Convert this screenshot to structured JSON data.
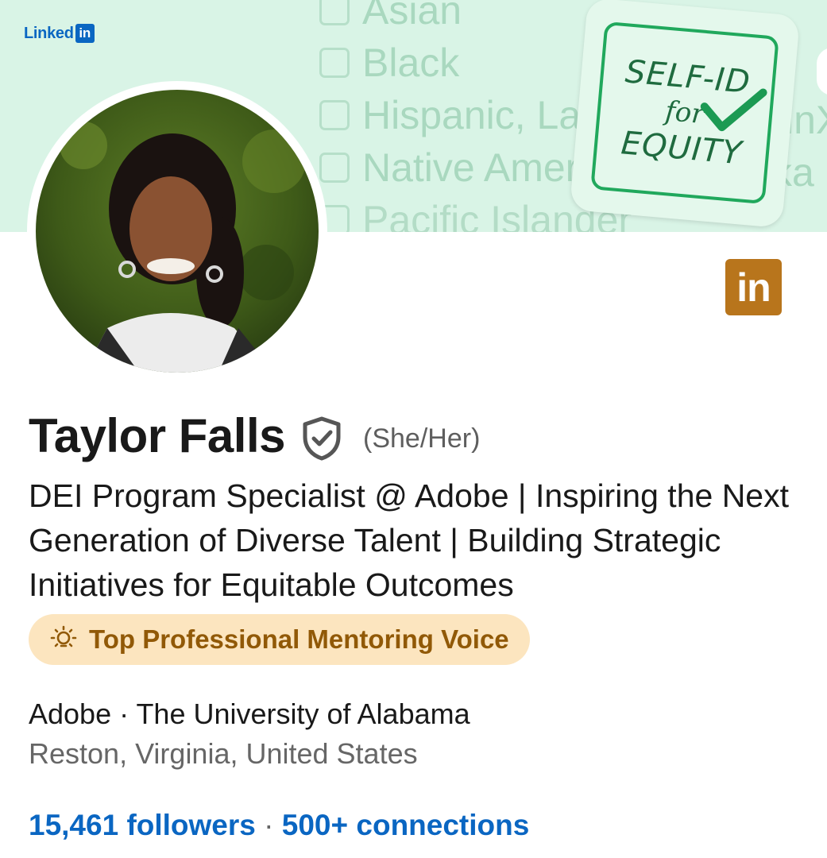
{
  "banner": {
    "logo_text": "Linked",
    "logo_box": "in",
    "checkbox_options": [
      "Asian",
      "Black",
      "Hispanic, Lat",
      "Native Amer",
      "Pacific Islander"
    ],
    "right_fragments": [
      "inX",
      "ka I"
    ],
    "sticker": {
      "line1": "SELF-ID",
      "line2": "for",
      "line3": "EQUITY"
    },
    "background_color": "#d9f4e6",
    "sticker_accent": "#20a85c"
  },
  "profile": {
    "name": "Taylor Falls",
    "verified_icon": "shield-check-icon",
    "pronouns": "(She/Her)",
    "headline": "DEI Program Specialist @ Adobe | Inspiring the Next Generation of Diverse Talent | Building Strategic Initiatives for Equitable Outcomes",
    "badge": {
      "icon": "lightbulb-icon",
      "label": "Top Professional Mentoring Voice",
      "color": "#915907",
      "background": "#fce5bf"
    },
    "organizations": "Adobe · The University of Alabama",
    "location": "Reston, Virginia, United States",
    "followers": "15,461 followers",
    "separator": "·",
    "connections": "500+ connections",
    "in_badge": "in",
    "in_badge_color": "#b8751c",
    "link_color": "#0a66c2"
  }
}
